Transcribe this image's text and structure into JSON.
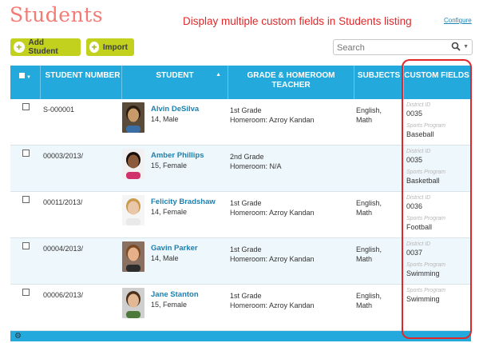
{
  "page": {
    "title": "Students",
    "configure_link": "Configure"
  },
  "annotation": {
    "text": "Display multiple custom fields in Students listing",
    "color": "#e0282a"
  },
  "toolbar": {
    "add_label": "Add Student",
    "import_label": "Import"
  },
  "search": {
    "placeholder": "Search"
  },
  "table": {
    "headers": {
      "number": "STUDENT NUMBER",
      "student": "STUDENT",
      "grade": "GRADE & HOMEROOM TEACHER",
      "subjects": "SUBJECTS",
      "custom": "CUSTOM FIELDS"
    },
    "rows": [
      {
        "number": "S-000001",
        "name": "Alvin DeSilva",
        "info": "14, Male",
        "grade": "1st Grade",
        "homeroom": "Homeroom: Azroy Kandan",
        "subjects": [
          "English,",
          "Math"
        ],
        "custom": [
          {
            "label": "District ID",
            "value": "0035"
          },
          {
            "label": "Sports Program",
            "value": "Baseball"
          }
        ]
      },
      {
        "number": "00003/2013/",
        "name": "Amber Phillips",
        "info": "15, Female",
        "grade": "2nd Grade",
        "homeroom": "Homeroom: N/A",
        "subjects": [
          "",
          ""
        ],
        "custom": [
          {
            "label": "District ID",
            "value": "0035"
          },
          {
            "label": "Sports Program",
            "value": "Basketball"
          }
        ]
      },
      {
        "number": "00011/2013/",
        "name": "Felicity Bradshaw",
        "info": "14, Female",
        "grade": "1st Grade",
        "homeroom": "Homeroom: Azroy Kandan",
        "subjects": [
          "English,",
          "Math"
        ],
        "custom": [
          {
            "label": "District ID",
            "value": "0036"
          },
          {
            "label": "Sports Program",
            "value": "Football"
          }
        ]
      },
      {
        "number": "00004/2013/",
        "name": "Gavin Parker",
        "info": "14, Male",
        "grade": "1st Grade",
        "homeroom": "Homeroom: Azroy Kandan",
        "subjects": [
          "English,",
          "Math"
        ],
        "custom": [
          {
            "label": "District ID",
            "value": "0037"
          },
          {
            "label": "Sports Program",
            "value": "Swimming"
          }
        ]
      },
      {
        "number": "00006/2013/",
        "name": "Jane Stanton",
        "info": "15, Female",
        "grade": "1st Grade",
        "homeroom": "Homeroom: Azroy Kandan",
        "subjects": [
          "English,",
          "Math"
        ],
        "custom": [
          {
            "label": "Sports Program",
            "value": "Swimming"
          }
        ]
      }
    ]
  },
  "colors": {
    "title": "#f47a74",
    "header_bg": "#23a9dc",
    "button_bg": "#c1d11d",
    "link": "#1d7fae"
  }
}
